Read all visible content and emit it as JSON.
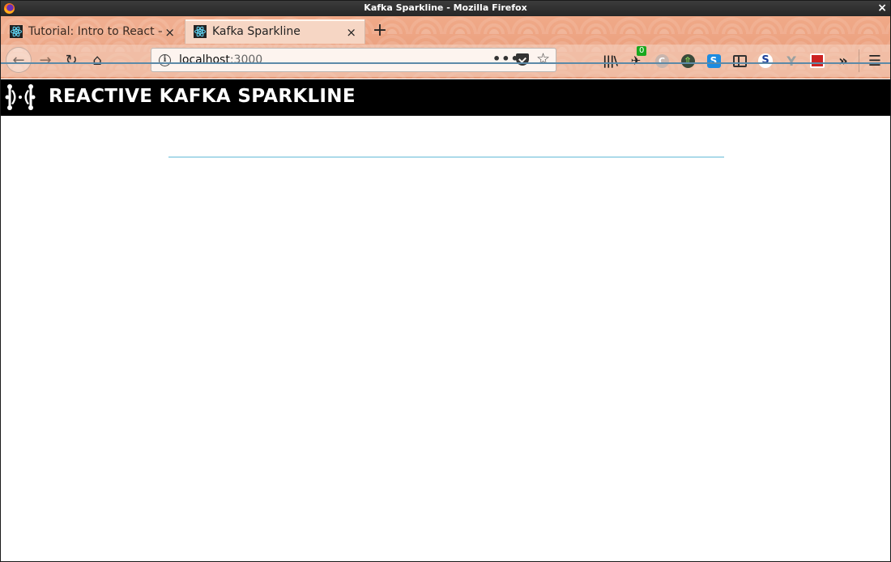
{
  "window": {
    "title": "Kafka Sparkline - Mozilla Firefox",
    "close_glyph": "×"
  },
  "tabs": [
    {
      "label": "Tutorial: Intro to React – R",
      "close_glyph": "×"
    },
    {
      "label": "Kafka Sparkline",
      "close_glyph": "×",
      "active": true
    }
  ],
  "new_tab_glyph": "+",
  "urlbar": {
    "host": "localhost",
    "port": ":3000",
    "info_glyph": "i",
    "dots": "•••",
    "star_glyph": "☆"
  },
  "toolbar": {
    "back_glyph": "←",
    "forward_glyph": "→",
    "reload_glyph": "↻",
    "home_glyph": "⌂",
    "library_glyph": "|||\\",
    "ext1_badge": "0",
    "ext2_letter": "C",
    "ext3_glyph": "⇧",
    "ext4_letter": "S",
    "ext6_letter": "S",
    "ext7_letter": "Y",
    "more_glyph": "»",
    "menu_glyph": "☰"
  },
  "app": {
    "title": "REACTIVE KAFKA SPARKLINE"
  },
  "colors": {
    "sparkline": "#5ab4d6",
    "header_bg": "#000000",
    "theme": "#e9a07f"
  },
  "chart_data": {
    "type": "line",
    "values": [
      0,
      0,
      0,
      0,
      0,
      0,
      0,
      0,
      0,
      0,
      0,
      0,
      0,
      0,
      0,
      0,
      0,
      0,
      0,
      0
    ]
  }
}
